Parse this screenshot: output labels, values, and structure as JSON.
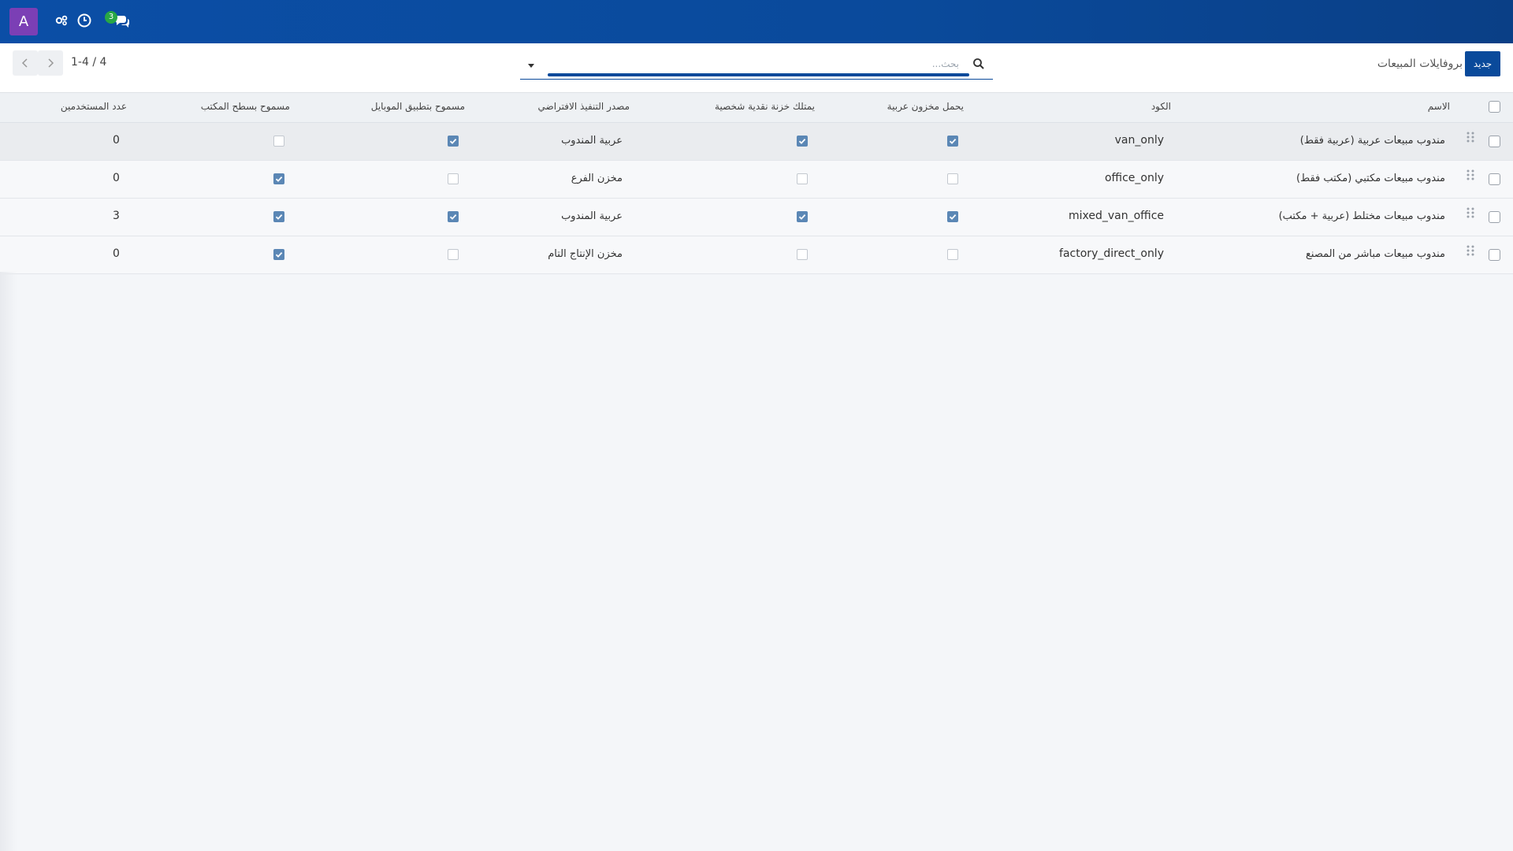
{
  "navbar": {
    "avatar_letter": "A",
    "chat_count": "3",
    "icons": [
      "users-cog-icon",
      "clock-icon",
      "chat-icon"
    ],
    "colors": {
      "bar": "#0a4a9b",
      "avatar": "#7b3fb5",
      "badge": "#28a745"
    }
  },
  "control": {
    "new_label": "جديد",
    "breadcrumb": "بروفايلات المبيعات",
    "search_placeholder": "بحث...",
    "pager": "1-4 / 4"
  },
  "table": {
    "headers": {
      "name": "الاسم",
      "code": "الكود",
      "carries_van_stock": "يحمل مخزون عربية",
      "has_cash_box": "يمتلك خزنة نقدية شخصية",
      "default_source": "مصدر التنفيذ الافتراضي",
      "mobile_allowed": "مسموح بتطبيق الموبايل",
      "desktop_allowed": "مسموح بسطح المكتب",
      "user_count": "عدد المستخدمين"
    },
    "rows": [
      {
        "name": "مندوب مبيعات عربية (عربية فقط)",
        "code": "van_only",
        "carries_van_stock": true,
        "has_cash_box": true,
        "default_source": "عربية المندوب",
        "mobile_allowed": true,
        "desktop_allowed": false,
        "user_count": "0"
      },
      {
        "name": "مندوب مبيعات مكتبي (مكتب فقط)",
        "code": "office_only",
        "carries_van_stock": false,
        "has_cash_box": false,
        "default_source": "مخزن الفرع",
        "mobile_allowed": false,
        "desktop_allowed": true,
        "user_count": "0"
      },
      {
        "name": "مندوب مبيعات مختلط (عربية + مكتب)",
        "code": "mixed_van_office",
        "carries_van_stock": true,
        "has_cash_box": true,
        "default_source": "عربية المندوب",
        "mobile_allowed": true,
        "desktop_allowed": true,
        "user_count": "3"
      },
      {
        "name": "مندوب مبيعات مباشر من المصنع",
        "code": "factory_direct_only",
        "carries_van_stock": false,
        "has_cash_box": false,
        "default_source": "مخزن الإنتاج التام",
        "mobile_allowed": false,
        "desktop_allowed": true,
        "user_count": "0"
      }
    ]
  }
}
